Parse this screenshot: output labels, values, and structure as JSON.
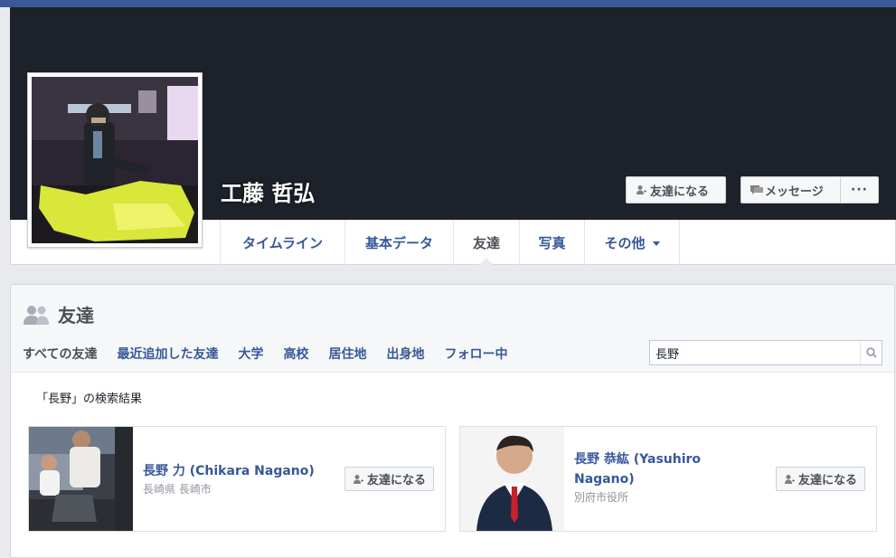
{
  "profile": {
    "name": "工藤 哲弘",
    "add_friend_label": "友達になる",
    "message_label": "メッセージ",
    "more_label": "···"
  },
  "nav": {
    "tabs": [
      {
        "label": "タイムライン"
      },
      {
        "label": "基本データ"
      },
      {
        "label": "友達"
      },
      {
        "label": "写真"
      },
      {
        "label": "その他"
      }
    ]
  },
  "friends": {
    "title": "友達",
    "subtabs": [
      {
        "label": "すべての友達"
      },
      {
        "label": "最近追加した友達"
      },
      {
        "label": "大学"
      },
      {
        "label": "高校"
      },
      {
        "label": "居住地"
      },
      {
        "label": "出身地"
      },
      {
        "label": "フォロー中"
      }
    ],
    "search_value": "長野",
    "result_label": "「長野」の検索結果",
    "results": [
      {
        "name": "長野 力 (Chikara Nagano)",
        "sub": "長崎県 長崎市",
        "button": "友達になる"
      },
      {
        "name": "長野 恭紘 (Yasuhiro Nagano)",
        "sub": "別府市役所",
        "button": "友達になる"
      }
    ]
  },
  "colors": {
    "brand": "#3b5998",
    "link": "#365899",
    "cover": "#1d2129"
  }
}
